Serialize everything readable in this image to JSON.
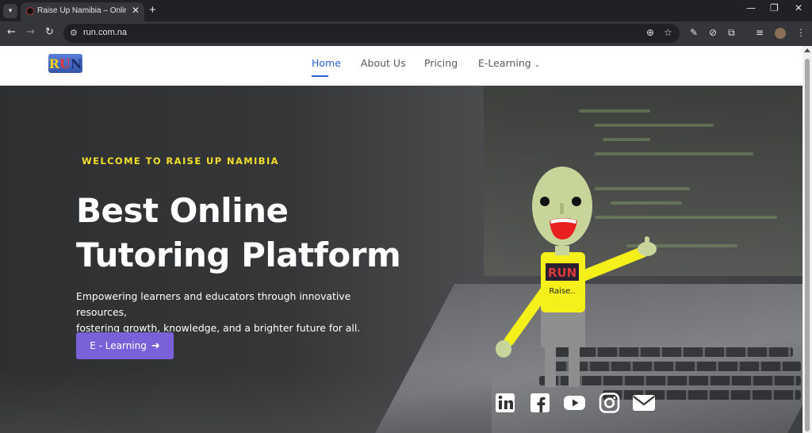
{
  "browser": {
    "tab_title": "Raise Up Namibia – Online Tuto",
    "url": "run.com.na",
    "new_tab_glyph": "+",
    "close_glyph": "✕"
  },
  "site": {
    "logo_letters": [
      "R",
      "U",
      "N"
    ],
    "nav": [
      "Home",
      "About Us",
      "Pricing",
      "E-Learning"
    ],
    "active_nav": "Home"
  },
  "hero": {
    "eyebrow": "WELCOME TO RAISE UP NAMIBIA",
    "title_line1": "Best Online",
    "title_line2": "Tutoring Platform",
    "subtitle_line1": "Empowering learners and educators through innovative resources,",
    "subtitle_line2": "fostering growth, knowledge, and a brighter future for all.",
    "cta_label": "E - Learning",
    "mascot_shirt_logo": "RUN",
    "mascot_shirt_text": "Raise.."
  },
  "social_icons": [
    "linkedin-icon",
    "facebook-icon",
    "youtube-icon",
    "instagram-icon",
    "email-icon"
  ],
  "colors": {
    "accent_yellow": "#f2df2c",
    "nav_active": "#2b5fd9",
    "cta_purple": "#7b61d9",
    "mascot_shirt": "#f5ef1a",
    "mascot_skin": "#c7d59a"
  }
}
